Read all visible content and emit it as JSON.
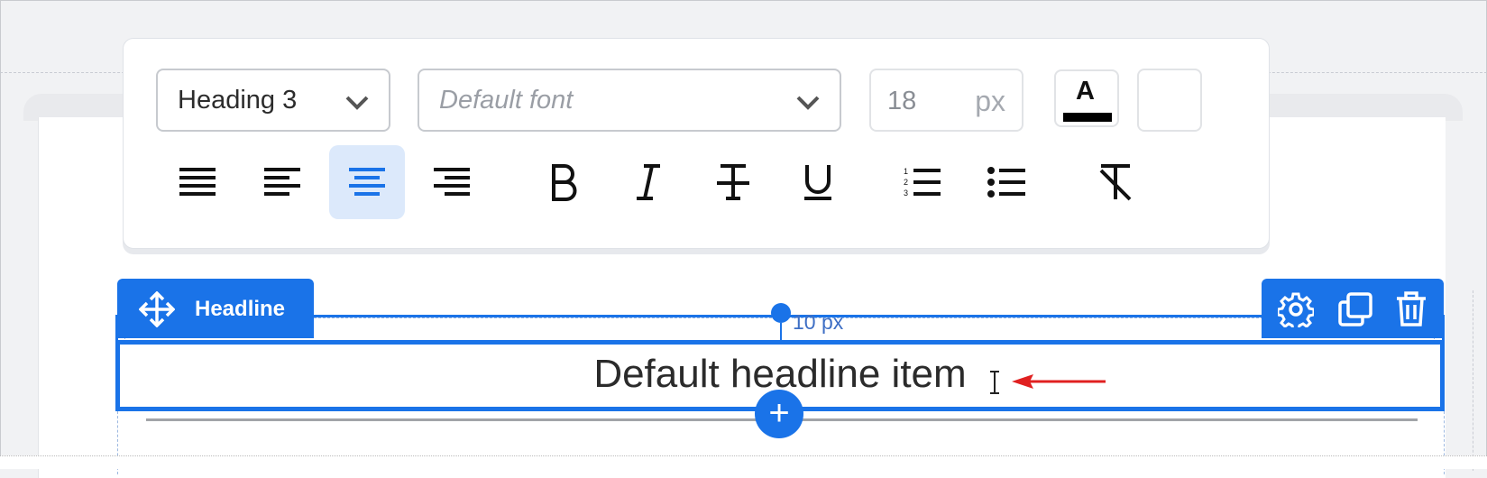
{
  "toolbar": {
    "heading_select": "Heading 3",
    "font_select": "Default font",
    "font_size": "18",
    "font_size_unit": "px",
    "text_color_letter": "A",
    "text_color": "#000000",
    "buttons": [
      "align-justify",
      "align-left",
      "align-center",
      "align-right",
      "bold",
      "italic",
      "strikethrough",
      "underline",
      "ordered-list",
      "unordered-list",
      "clear-format"
    ],
    "active_alignment": "align-center"
  },
  "block": {
    "tab_label": "Headline",
    "padding_label": "10 px",
    "headline_text": "Default headline item",
    "accent_color": "#1a73e8"
  }
}
